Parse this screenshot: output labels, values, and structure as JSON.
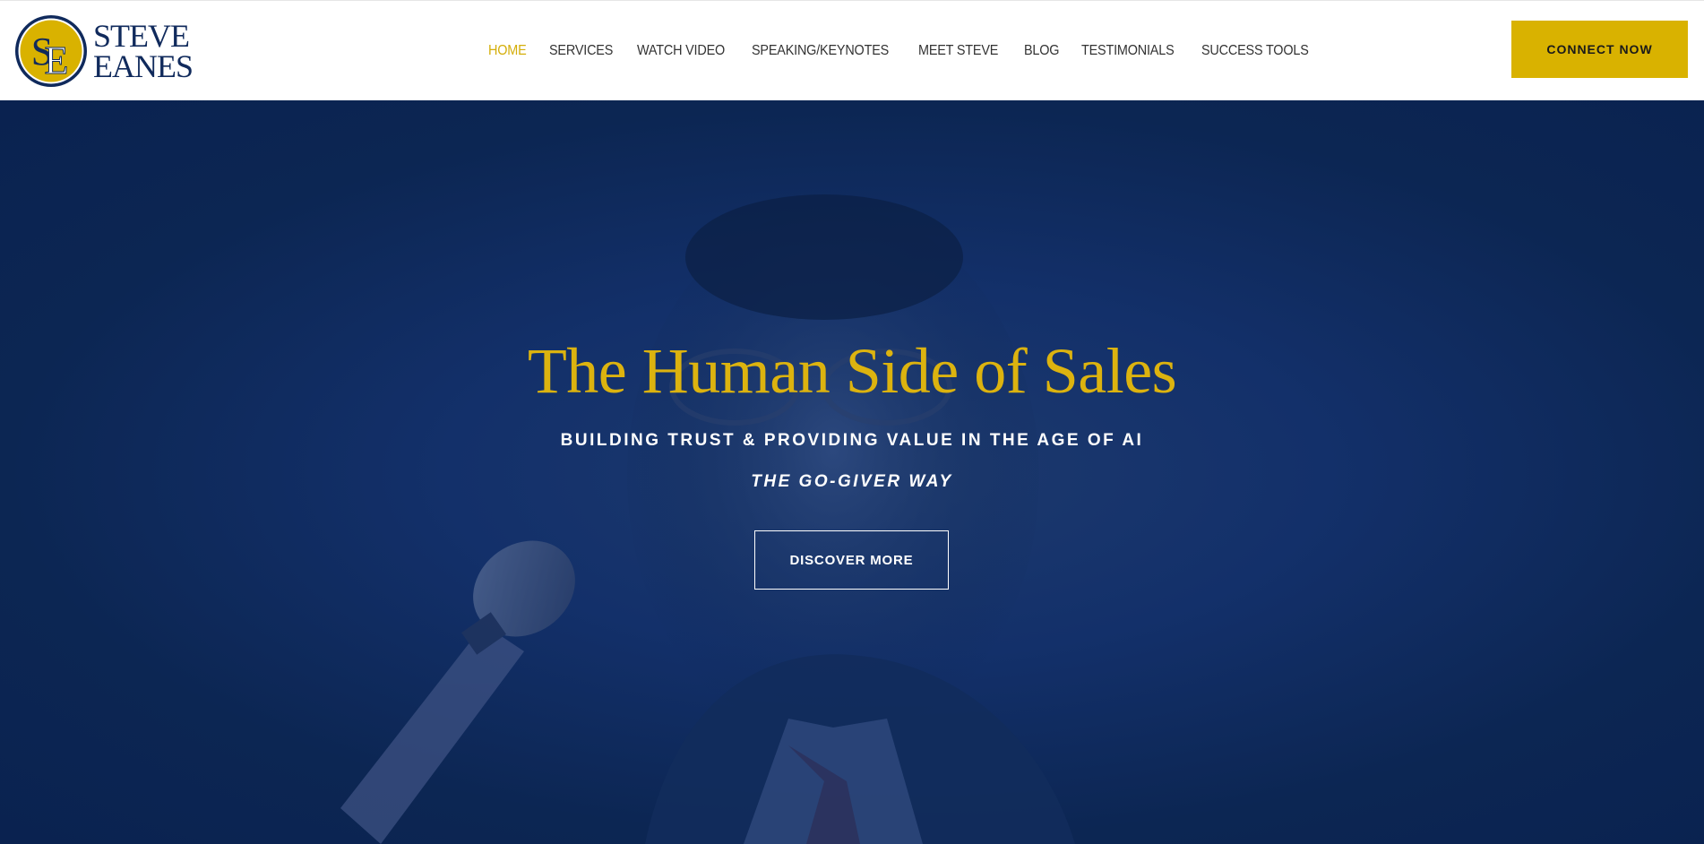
{
  "header": {
    "logo": {
      "monogram": "SE",
      "line1": "STEVE",
      "line2": "EANES"
    },
    "nav": [
      {
        "label": "HOME",
        "active": true
      },
      {
        "label": "SERVICES",
        "active": false
      },
      {
        "label": "WATCH VIDEO",
        "active": false
      },
      {
        "label": "SPEAKING/KEYNOTES",
        "active": false
      },
      {
        "label": "MEET STEVE",
        "active": false
      },
      {
        "label": "BLOG",
        "active": false
      },
      {
        "label": "TESTIMONIALS",
        "active": false
      },
      {
        "label": "SUCCESS TOOLS",
        "active": false
      }
    ],
    "cta_label": "CONNECT NOW"
  },
  "hero": {
    "title": "The Human Side of Sales",
    "subtitle": "BUILDING TRUST & PROVIDING VALUE IN THE AGE OF AI",
    "tagline": "THE GO-GIVER WAY",
    "button_label": "DISCOVER MORE",
    "background_image": "speaker-with-microphone-photo"
  },
  "colors": {
    "brand_navy": "#102a5c",
    "brand_gold": "#d9b200",
    "hero_overlay": "#0c2653",
    "nav_active": "#d4ae0a",
    "nav_text": "#333333"
  }
}
